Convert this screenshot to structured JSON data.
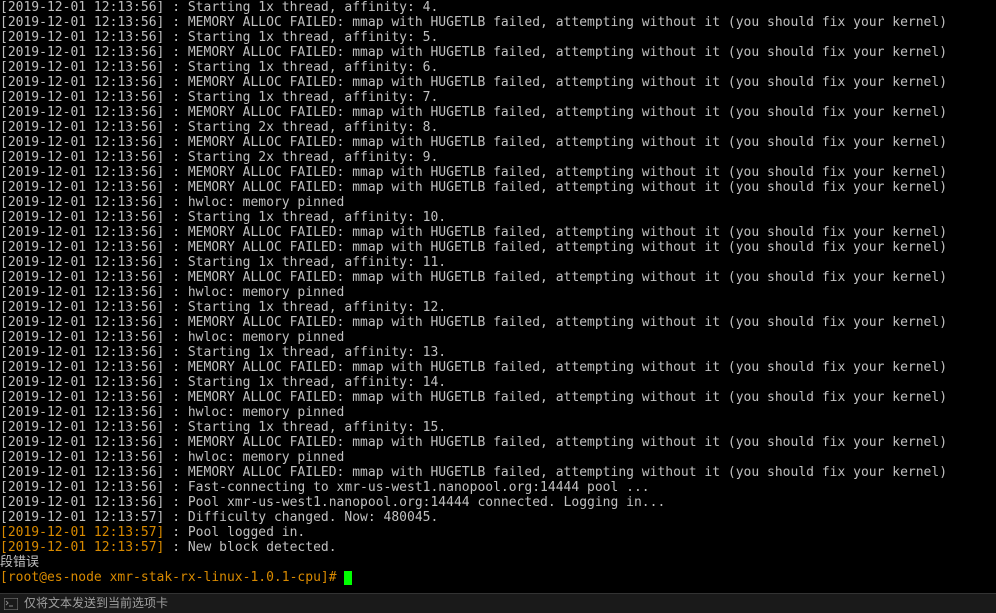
{
  "log_lines": [
    {
      "ts": "[2019-12-01 12:13:56]",
      "msg": " : Starting 1x thread, affinity: 4."
    },
    {
      "ts": "[2019-12-01 12:13:56]",
      "msg": " : MEMORY ALLOC FAILED: mmap with HUGETLB failed, attempting without it (you should fix your kernel)"
    },
    {
      "ts": "[2019-12-01 12:13:56]",
      "msg": " : Starting 1x thread, affinity: 5."
    },
    {
      "ts": "[2019-12-01 12:13:56]",
      "msg": " : MEMORY ALLOC FAILED: mmap with HUGETLB failed, attempting without it (you should fix your kernel)"
    },
    {
      "ts": "[2019-12-01 12:13:56]",
      "msg": " : Starting 1x thread, affinity: 6."
    },
    {
      "ts": "[2019-12-01 12:13:56]",
      "msg": " : MEMORY ALLOC FAILED: mmap with HUGETLB failed, attempting without it (you should fix your kernel)"
    },
    {
      "ts": "[2019-12-01 12:13:56]",
      "msg": " : Starting 1x thread, affinity: 7."
    },
    {
      "ts": "[2019-12-01 12:13:56]",
      "msg": " : MEMORY ALLOC FAILED: mmap with HUGETLB failed, attempting without it (you should fix your kernel)"
    },
    {
      "ts": "[2019-12-01 12:13:56]",
      "msg": " : Starting 2x thread, affinity: 8."
    },
    {
      "ts": "[2019-12-01 12:13:56]",
      "msg": " : MEMORY ALLOC FAILED: mmap with HUGETLB failed, attempting without it (you should fix your kernel)"
    },
    {
      "ts": "[2019-12-01 12:13:56]",
      "msg": " : Starting 2x thread, affinity: 9."
    },
    {
      "ts": "[2019-12-01 12:13:56]",
      "msg": " : MEMORY ALLOC FAILED: mmap with HUGETLB failed, attempting without it (you should fix your kernel)"
    },
    {
      "ts": "[2019-12-01 12:13:56]",
      "msg": " : MEMORY ALLOC FAILED: mmap with HUGETLB failed, attempting without it (you should fix your kernel)"
    },
    {
      "ts": "[2019-12-01 12:13:56]",
      "msg": " : hwloc: memory pinned"
    },
    {
      "ts": "[2019-12-01 12:13:56]",
      "msg": " : Starting 1x thread, affinity: 10."
    },
    {
      "ts": "[2019-12-01 12:13:56]",
      "msg": " : MEMORY ALLOC FAILED: mmap with HUGETLB failed, attempting without it (you should fix your kernel)"
    },
    {
      "ts": "[2019-12-01 12:13:56]",
      "msg": " : MEMORY ALLOC FAILED: mmap with HUGETLB failed, attempting without it (you should fix your kernel)"
    },
    {
      "ts": "[2019-12-01 12:13:56]",
      "msg": " : Starting 1x thread, affinity: 11."
    },
    {
      "ts": "[2019-12-01 12:13:56]",
      "msg": " : MEMORY ALLOC FAILED: mmap with HUGETLB failed, attempting without it (you should fix your kernel)"
    },
    {
      "ts": "[2019-12-01 12:13:56]",
      "msg": " : hwloc: memory pinned"
    },
    {
      "ts": "[2019-12-01 12:13:56]",
      "msg": " : Starting 1x thread, affinity: 12."
    },
    {
      "ts": "[2019-12-01 12:13:56]",
      "msg": " : MEMORY ALLOC FAILED: mmap with HUGETLB failed, attempting without it (you should fix your kernel)"
    },
    {
      "ts": "[2019-12-01 12:13:56]",
      "msg": " : hwloc: memory pinned"
    },
    {
      "ts": "[2019-12-01 12:13:56]",
      "msg": " : Starting 1x thread, affinity: 13."
    },
    {
      "ts": "[2019-12-01 12:13:56]",
      "msg": " : MEMORY ALLOC FAILED: mmap with HUGETLB failed, attempting without it (you should fix your kernel)"
    },
    {
      "ts": "[2019-12-01 12:13:56]",
      "msg": " : Starting 1x thread, affinity: 14."
    },
    {
      "ts": "[2019-12-01 12:13:56]",
      "msg": " : MEMORY ALLOC FAILED: mmap with HUGETLB failed, attempting without it (you should fix your kernel)"
    },
    {
      "ts": "[2019-12-01 12:13:56]",
      "msg": " : hwloc: memory pinned"
    },
    {
      "ts": "[2019-12-01 12:13:56]",
      "msg": " : Starting 1x thread, affinity: 15."
    },
    {
      "ts": "[2019-12-01 12:13:56]",
      "msg": " : MEMORY ALLOC FAILED: mmap with HUGETLB failed, attempting without it (you should fix your kernel)"
    },
    {
      "ts": "[2019-12-01 12:13:56]",
      "msg": " : hwloc: memory pinned"
    },
    {
      "ts": "[2019-12-01 12:13:56]",
      "msg": " : MEMORY ALLOC FAILED: mmap with HUGETLB failed, attempting without it (you should fix your kernel)"
    },
    {
      "ts": "[2019-12-01 12:13:56]",
      "msg": " : Fast-connecting to xmr-us-west1.nanopool.org:14444 pool ..."
    },
    {
      "ts": "[2019-12-01 12:13:56]",
      "msg": " : Pool xmr-us-west1.nanopool.org:14444 connected. Logging in..."
    },
    {
      "ts": "[2019-12-01 12:13:57]",
      "msg": " : Difficulty changed. Now: 480045."
    },
    {
      "ts": "[2019-12-01 12:13:57]",
      "msg": " : Pool logged in.",
      "orange_ts": true
    },
    {
      "ts": "[2019-12-01 12:13:57]",
      "msg": " : New block detected.",
      "orange_ts": true
    }
  ],
  "segfault_text": "段错误",
  "prompt_text": "[root@es-node xmr-stak-rx-linux-1.0.1-cpu]# ",
  "statusbar_text": "仅将文本发送到当前选项卡"
}
